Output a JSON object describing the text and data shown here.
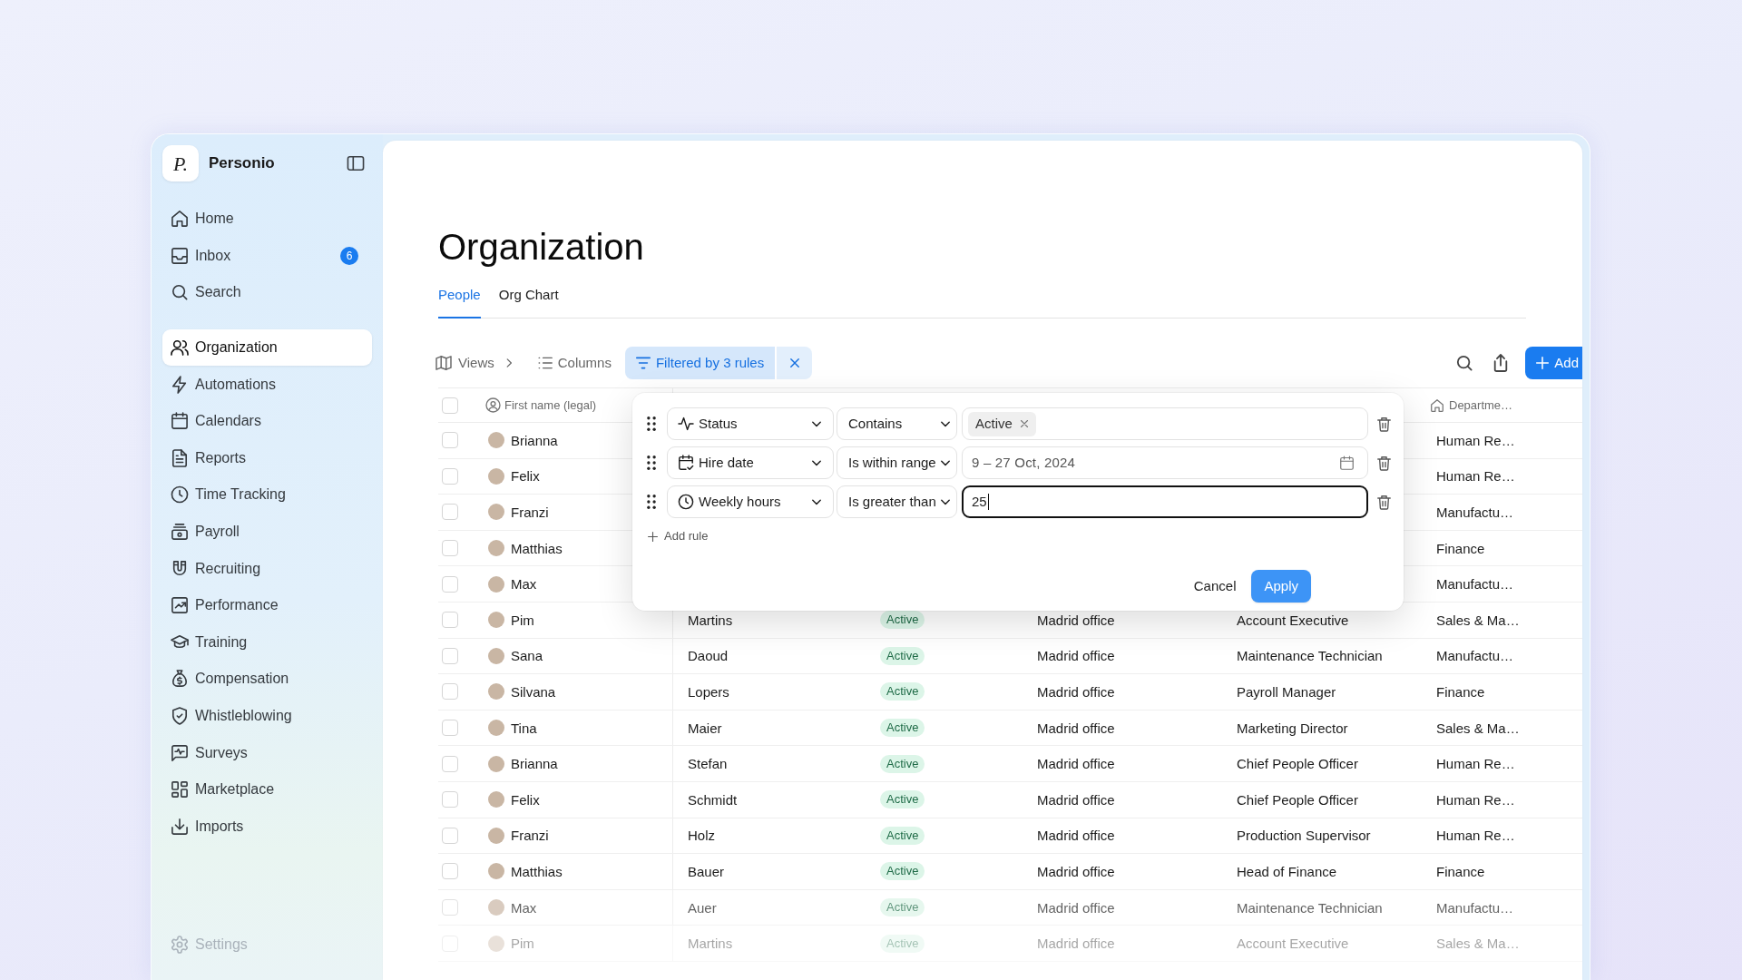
{
  "sidebar": {
    "logo": "P.",
    "brand": "Personio",
    "nav_groups": [
      {
        "items": [
          {
            "label": "Home",
            "selected": false
          },
          {
            "label": "Inbox",
            "selected": false,
            "badge": "6"
          },
          {
            "label": "Search",
            "selected": false
          }
        ]
      },
      {
        "items": [
          {
            "label": "Organization",
            "selected": true
          },
          {
            "label": "Automations",
            "selected": false
          },
          {
            "label": "Calendars",
            "selected": false
          },
          {
            "label": "Reports",
            "selected": false
          },
          {
            "label": "Time Tracking",
            "selected": false
          },
          {
            "label": "Payroll",
            "selected": false
          },
          {
            "label": "Recruiting",
            "selected": false
          },
          {
            "label": "Performance",
            "selected": false
          },
          {
            "label": "Training",
            "selected": false
          },
          {
            "label": "Compensation",
            "selected": false
          },
          {
            "label": "Whistleblowing",
            "selected": false
          },
          {
            "label": "Surveys",
            "selected": false
          },
          {
            "label": "Marketplace",
            "selected": false
          },
          {
            "label": "Imports",
            "selected": false
          }
        ]
      }
    ],
    "footer_item": {
      "label": "Settings"
    }
  },
  "page": {
    "title": "Organization",
    "tabs": [
      {
        "label": "People",
        "selected": true
      },
      {
        "label": "Org Chart",
        "selected": false
      }
    ]
  },
  "toolbar": {
    "views": "Views",
    "columns": "Columns",
    "filter_chip": "Filtered by 3 rules",
    "add_button": "Add"
  },
  "table": {
    "select_all_checked": false,
    "header": {
      "first_name": "First name (legal)",
      "department": "Departme…"
    },
    "rows": [
      {
        "checked": false,
        "first_name": "Brianna",
        "department": "Human Re…"
      },
      {
        "checked": false,
        "first_name": "Felix",
        "department": "Human Re…"
      },
      {
        "checked": false,
        "first_name": "Franzi",
        "department": "Manufactu…"
      },
      {
        "checked": false,
        "first_name": "Matthias",
        "department": "Finance"
      },
      {
        "checked": false,
        "first_name": "Max",
        "department": "Manufactu…"
      },
      {
        "checked": false,
        "first_name": "Pim",
        "last_name": "Martins",
        "status": "Active",
        "office": "Madrid office",
        "job": "Account Executive",
        "department": "Sales & Ma…"
      },
      {
        "checked": false,
        "first_name": "Sana",
        "last_name": "Daoud",
        "status": "Active",
        "office": "Madrid office",
        "job": "Maintenance Technician",
        "department": "Manufactu…"
      },
      {
        "checked": false,
        "first_name": "Silvana",
        "last_name": "Lopers",
        "status": "Active",
        "office": "Madrid office",
        "job": "Payroll Manager",
        "department": "Finance"
      },
      {
        "checked": false,
        "first_name": "Tina",
        "last_name": "Maier",
        "status": "Active",
        "office": "Madrid office",
        "job": "Marketing Director",
        "department": "Sales & Ma…"
      },
      {
        "checked": false,
        "first_name": "Brianna",
        "last_name": "Stefan",
        "status": "Active",
        "office": "Madrid office",
        "job": "Chief People Officer",
        "department": "Human Re…"
      },
      {
        "checked": false,
        "first_name": "Felix",
        "last_name": "Schmidt",
        "status": "Active",
        "office": "Madrid office",
        "job": "Chief People Officer",
        "department": "Human Re…"
      },
      {
        "checked": false,
        "first_name": "Franzi",
        "last_name": "Holz",
        "status": "Active",
        "office": "Madrid office",
        "job": "Production Supervisor",
        "department": "Human Re…"
      },
      {
        "checked": false,
        "first_name": "Matthias",
        "last_name": "Bauer",
        "status": "Active",
        "office": "Madrid office",
        "job": "Head of Finance",
        "department": "Finance"
      },
      {
        "checked": false,
        "first_name": "Max",
        "last_name": "Auer",
        "status": "Active",
        "office": "Madrid office",
        "job": "Maintenance Technician",
        "department": "Manufactu…"
      },
      {
        "checked": false,
        "first_name": "Pim",
        "last_name": "Martins",
        "status": "Active",
        "office": "Madrid office",
        "job": "Account Executive",
        "department": "Sales & Ma…"
      }
    ]
  },
  "filter_panel": {
    "rules": [
      {
        "kind": "tags",
        "field": "Status",
        "operator": "Contains",
        "tags": [
          "Active"
        ],
        "focused": false
      },
      {
        "kind": "date_range",
        "field": "Hire date",
        "operator": "Is within range",
        "value": "9 – 27 Oct, 2024",
        "focused": false
      },
      {
        "kind": "number",
        "field": "Weekly hours",
        "operator": "Is greater than",
        "value": "25",
        "focused": true
      }
    ],
    "add_rule": "Add rule",
    "cancel": "Cancel",
    "apply": "Apply"
  }
}
